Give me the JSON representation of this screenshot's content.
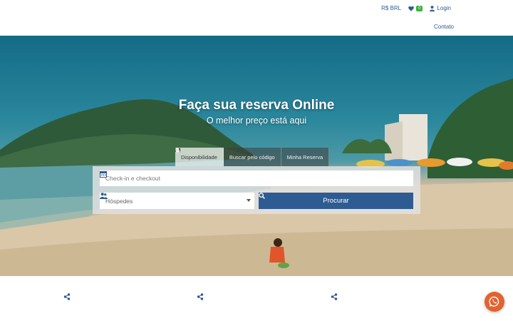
{
  "header": {
    "currency": "R$ BRL",
    "favorites_count": "0",
    "login_label": "Login",
    "contact_label": "Contato"
  },
  "hero": {
    "title": "Faça sua reserva Online",
    "subtitle": "O melhor preço está aqui"
  },
  "tabs": [
    {
      "label": "Disponibilidade",
      "icon": "calendar-icon",
      "active": true
    },
    {
      "label": "Buscar pelo código",
      "icon": "search-icon",
      "active": false
    },
    {
      "label": "Minha Reserva",
      "icon": "user-icon",
      "active": false
    }
  ],
  "search_form": {
    "checkin_placeholder": "Check-in e checkout",
    "guests_placeholder": "Hóspedes",
    "search_button": "Procurar"
  },
  "colors": {
    "primary": "#2f5b93",
    "badge": "#3ab23a",
    "whatsapp_button": "#e2632f"
  }
}
